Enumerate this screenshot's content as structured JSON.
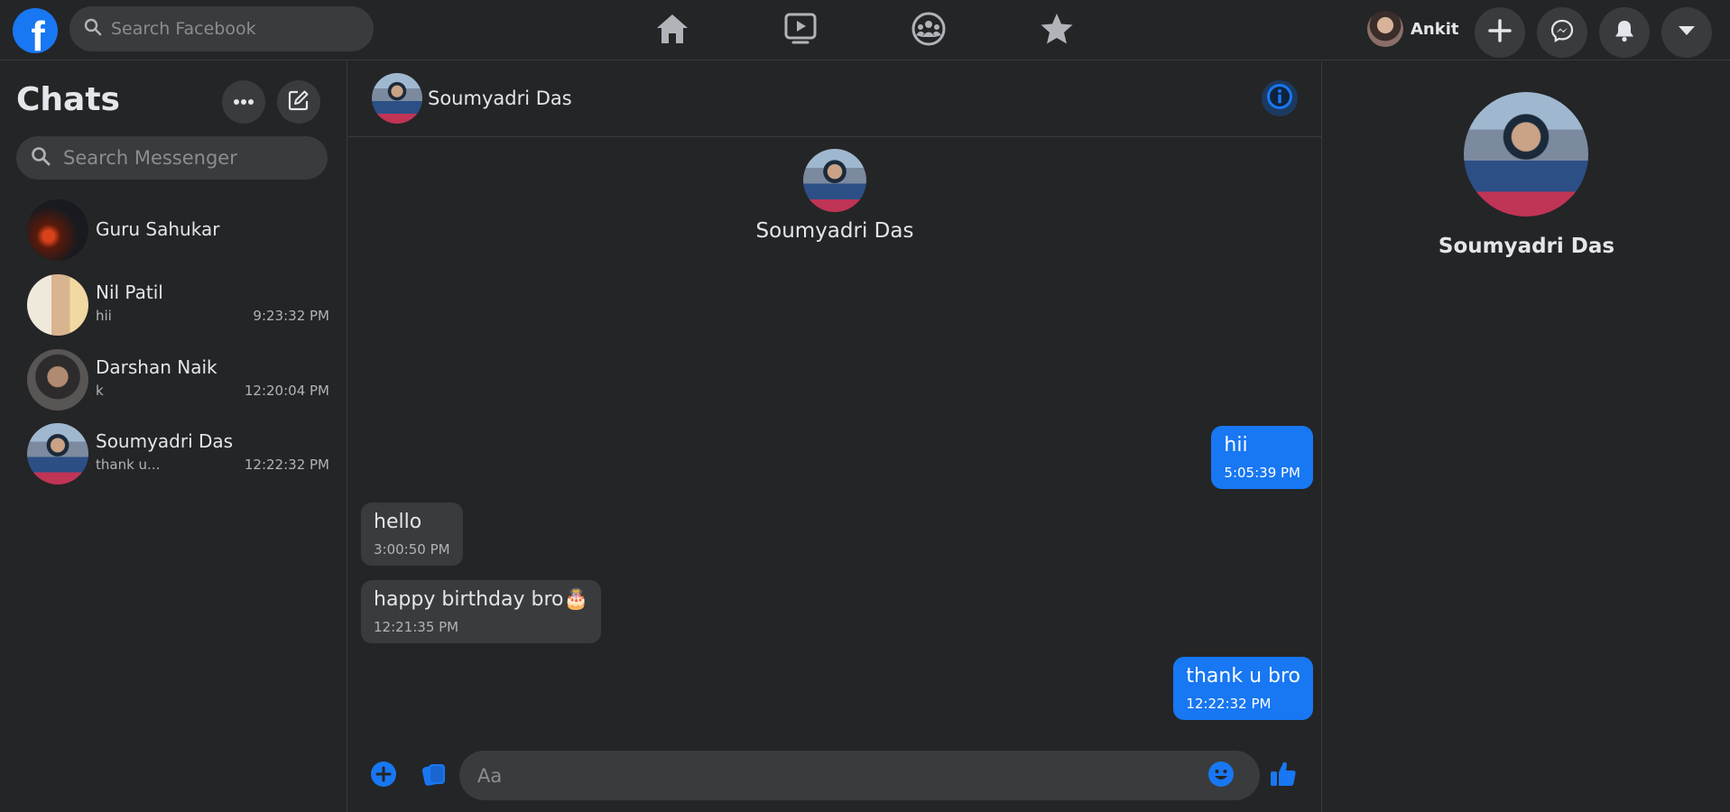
{
  "topbar": {
    "logo_letter": "f",
    "search_placeholder": "Search Facebook",
    "nav_icons": [
      "home-icon",
      "watch-icon",
      "groups-icon",
      "favorites-icon"
    ],
    "profile_name": "Ankit",
    "action_icons": [
      "plus-icon",
      "messenger-icon",
      "bell-icon",
      "caret-down-icon"
    ]
  },
  "sidebar": {
    "title": "Chats",
    "search_placeholder": "Search Messenger",
    "chats": [
      {
        "name": "Guru Sahukar",
        "preview": "",
        "time": ""
      },
      {
        "name": "Nil Patil",
        "preview": "hii",
        "time": "9:23:32 PM"
      },
      {
        "name": "Darshan Naik",
        "preview": "k",
        "time": "12:20:04 PM"
      },
      {
        "name": "Soumyadri Das",
        "preview": "thank u...",
        "time": "12:22:32 PM"
      }
    ]
  },
  "conversation": {
    "contact_name": "Soumyadri Das",
    "messages": [
      {
        "direction": "out",
        "text": "hii",
        "time": "5:05:39 PM"
      },
      {
        "direction": "in",
        "text": "hello",
        "time": "3:00:50 PM"
      },
      {
        "direction": "in",
        "text": "happy birthday bro🎂",
        "time": "12:21:35 PM"
      },
      {
        "direction": "out",
        "text": "thank u bro",
        "time": "12:22:32 PM"
      }
    ],
    "composer_placeholder": "Aa"
  },
  "right_panel": {
    "contact_name": "Soumyadri Das"
  },
  "colors": {
    "background": "#242526",
    "surface": "#3a3b3c",
    "accent": "#1877f2",
    "text": "#e4e6eb",
    "muted": "#b0b3b8"
  }
}
